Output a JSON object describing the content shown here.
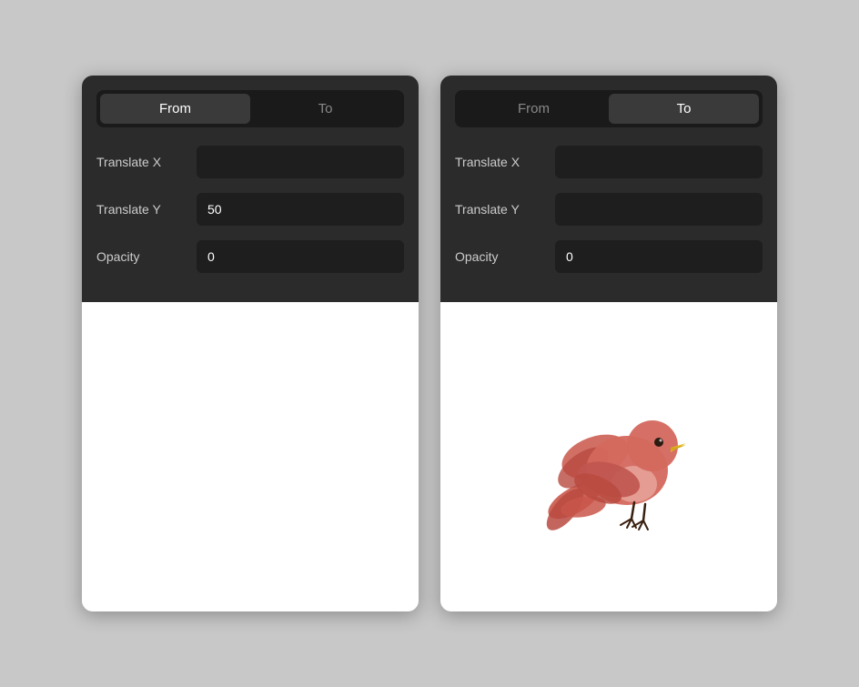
{
  "panels": [
    {
      "id": "left-panel",
      "tabs": [
        {
          "id": "from",
          "label": "From",
          "active": true
        },
        {
          "id": "to",
          "label": "To",
          "active": false
        }
      ],
      "fields": [
        {
          "id": "translate-x",
          "label": "Translate X",
          "value": ""
        },
        {
          "id": "translate-y",
          "label": "Translate Y",
          "value": "50"
        },
        {
          "id": "opacity",
          "label": "Opacity",
          "value": "0"
        }
      ],
      "showBird": false
    },
    {
      "id": "right-panel",
      "tabs": [
        {
          "id": "from",
          "label": "From",
          "active": false
        },
        {
          "id": "to",
          "label": "To",
          "active": true
        }
      ],
      "fields": [
        {
          "id": "translate-x",
          "label": "Translate X",
          "value": ""
        },
        {
          "id": "translate-y",
          "label": "Translate Y",
          "value": ""
        },
        {
          "id": "opacity",
          "label": "Opacity",
          "value": "0"
        }
      ],
      "showBird": true
    }
  ]
}
